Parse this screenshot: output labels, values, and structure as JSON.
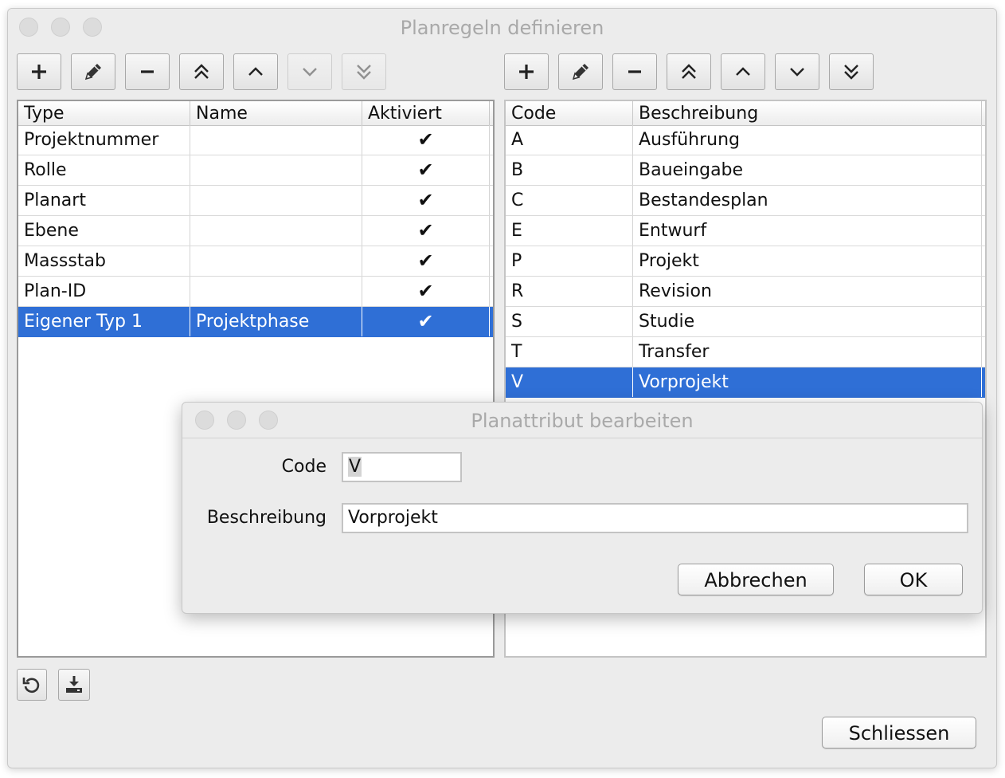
{
  "window": {
    "title": "Planregeln definieren"
  },
  "left_table": {
    "columns": [
      "Type",
      "Name",
      "Aktiviert"
    ],
    "rows": [
      {
        "type": "Projektnummer",
        "name": "",
        "aktiviert": "✔",
        "selected": false
      },
      {
        "type": "Rolle",
        "name": "",
        "aktiviert": "✔",
        "selected": false
      },
      {
        "type": "Planart",
        "name": "",
        "aktiviert": "✔",
        "selected": false
      },
      {
        "type": "Ebene",
        "name": "",
        "aktiviert": "✔",
        "selected": false
      },
      {
        "type": "Massstab",
        "name": "",
        "aktiviert": "✔",
        "selected": false
      },
      {
        "type": "Plan-ID",
        "name": "",
        "aktiviert": "✔",
        "selected": false
      },
      {
        "type": "Eigener Typ 1",
        "name": "Projektphase",
        "aktiviert": "✔",
        "selected": true
      }
    ]
  },
  "right_table": {
    "columns": [
      "Code",
      "Beschreibung"
    ],
    "rows": [
      {
        "code": "A",
        "beschreibung": "Ausführung",
        "selected": false
      },
      {
        "code": "B",
        "beschreibung": "Baueingabe",
        "selected": false
      },
      {
        "code": "C",
        "beschreibung": "Bestandesplan",
        "selected": false
      },
      {
        "code": "E",
        "beschreibung": "Entwurf",
        "selected": false
      },
      {
        "code": "P",
        "beschreibung": "Projekt",
        "selected": false
      },
      {
        "code": "R",
        "beschreibung": "Revision",
        "selected": false
      },
      {
        "code": "S",
        "beschreibung": "Studie",
        "selected": false
      },
      {
        "code": "T",
        "beschreibung": "Transfer",
        "selected": false
      },
      {
        "code": "V",
        "beschreibung": "Vorprojekt",
        "selected": true
      }
    ]
  },
  "toolbar_icons": [
    "plus-icon",
    "pencil-icon",
    "minus-icon",
    "double-chevron-up-icon",
    "chevron-up-icon",
    "chevron-down-icon",
    "double-chevron-down-icon"
  ],
  "bottom_icons": [
    "refresh-icon",
    "download-icon"
  ],
  "close_button": "Schliessen",
  "dialog": {
    "title": "Planattribut bearbeiten",
    "code_label": "Code",
    "code_value": "V",
    "description_label": "Beschreibung",
    "description_value": "Vorprojekt",
    "cancel_label": "Abbrechen",
    "ok_label": "OK"
  },
  "colors": {
    "selection": "#2f6fd6",
    "window_bg": "#ececec",
    "title_text": "#a9a9a9"
  }
}
